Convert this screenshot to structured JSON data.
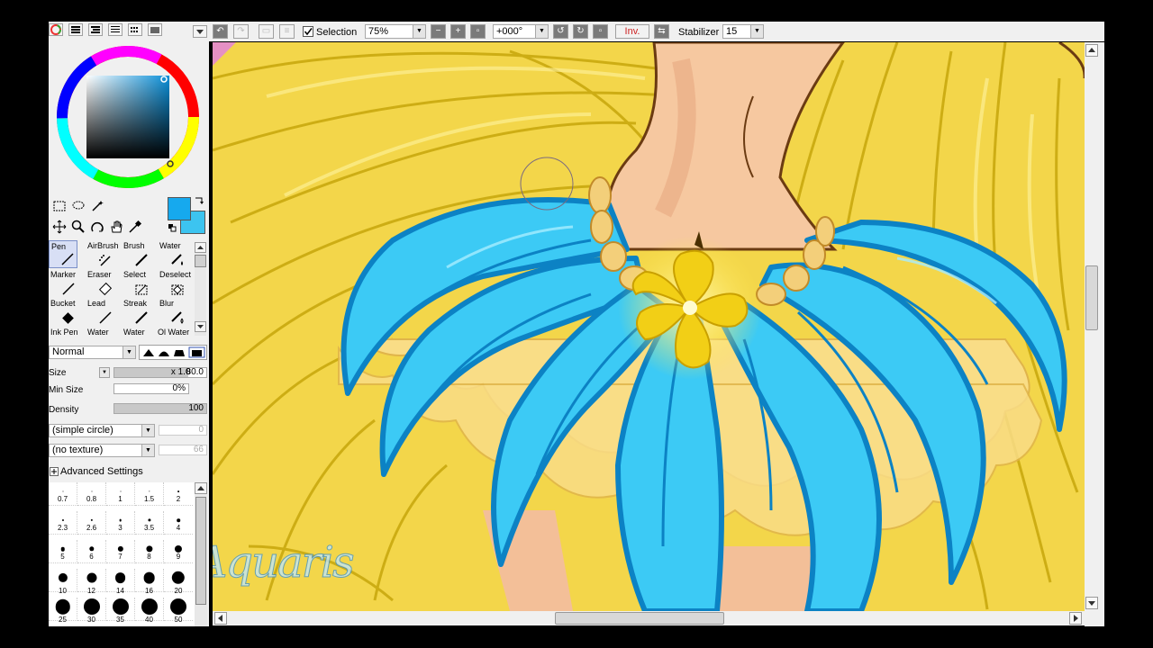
{
  "toolbar": {
    "selection_label": "Selection",
    "selection_checked": true,
    "zoom": "75%",
    "rotation": "+000°",
    "invert_label": "Inv.",
    "stabilizer_label": "Stabilizer",
    "stabilizer_value": "15"
  },
  "colors": {
    "primary": "#16a9ee",
    "secondary": "#3cc4f0",
    "accent_red": "#cc2222"
  },
  "tools": [
    {
      "label": "Pen",
      "icon": "pen-icon",
      "selected": true
    },
    {
      "label": "AirBrush",
      "icon": "airbrush-icon"
    },
    {
      "label": "Brush",
      "icon": "brush-icon"
    },
    {
      "label": "Water",
      "icon": "water-icon"
    },
    {
      "label": "Marker",
      "icon": "marker-icon"
    },
    {
      "label": "Eraser",
      "icon": "eraser-icon"
    },
    {
      "label": "Select",
      "icon": "select-icon"
    },
    {
      "label": "Deselect",
      "icon": "deselect-icon"
    },
    {
      "label": "Bucket",
      "icon": "bucket-icon"
    },
    {
      "label": "Lead",
      "icon": "lead-icon"
    },
    {
      "label": "Streak",
      "icon": "streak-icon"
    },
    {
      "label": "Blur",
      "icon": "blur-icon"
    }
  ],
  "tools_partial_row": [
    "Ink Pen",
    "Water",
    "Water",
    "Ol Water"
  ],
  "brush": {
    "blend_mode": "Normal",
    "size_label": "Size",
    "size_multiplier": "x 1.0",
    "size_value": "80.0",
    "min_size_label": "Min Size",
    "min_size_value": "0%",
    "density_label": "Density",
    "density_value": "100",
    "shape": "(simple circle)",
    "shape_value": "0",
    "texture": "(no texture)",
    "texture_value": "66",
    "advanced_label": "Advanced Settings"
  },
  "brush_sizes": [
    "0.7",
    "0.8",
    "1",
    "1.5",
    "2",
    "2.3",
    "2.6",
    "3",
    "3.5",
    "4",
    "5",
    "6",
    "7",
    "8",
    "9",
    "10",
    "12",
    "14",
    "16",
    "20",
    "25",
    "30",
    "35",
    "40",
    "50"
  ],
  "watermark": "AsrianaAquaris"
}
